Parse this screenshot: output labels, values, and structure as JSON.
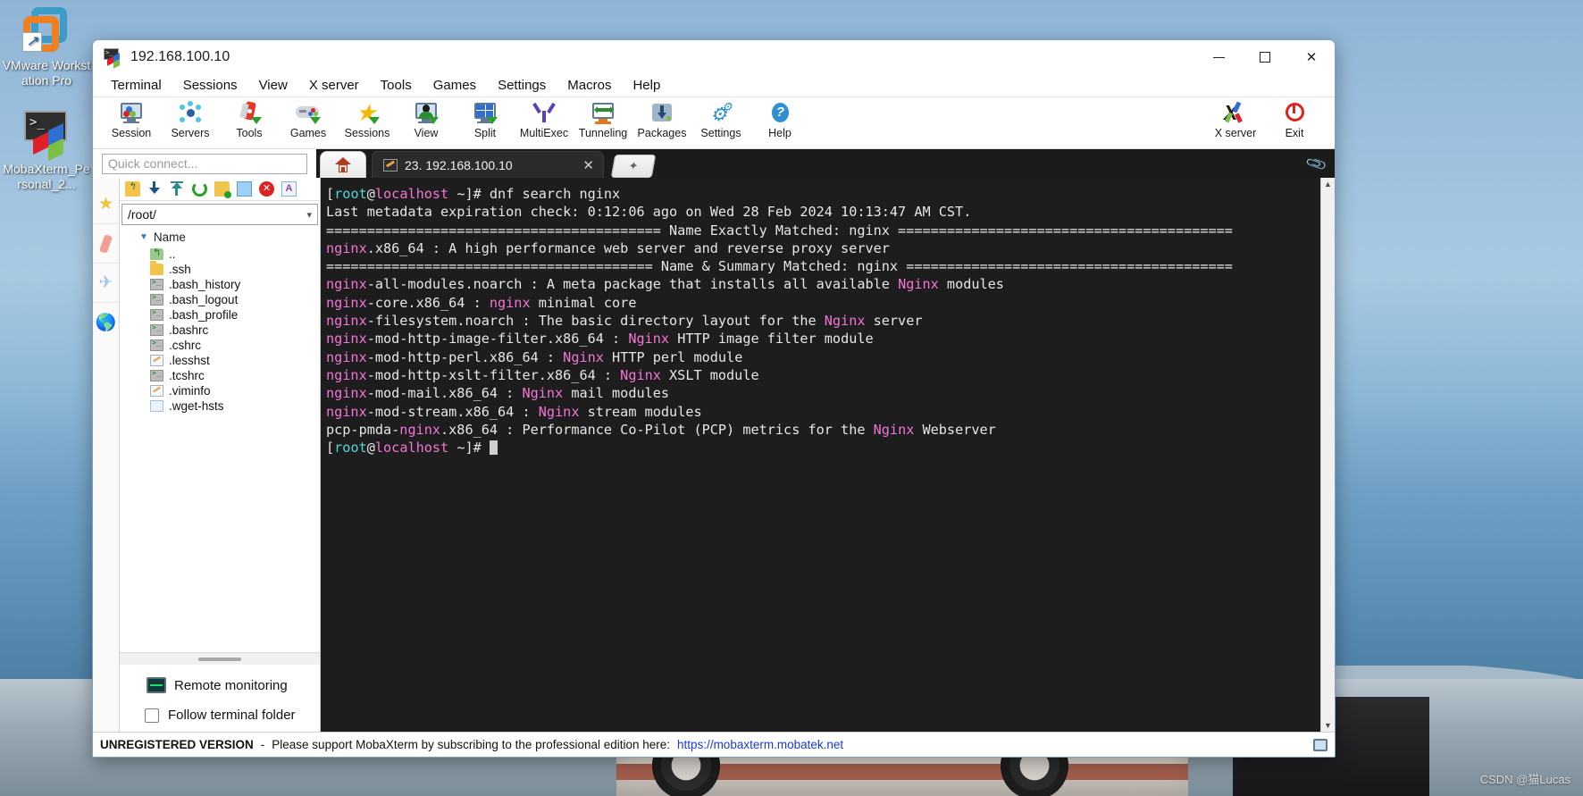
{
  "desktop": {
    "icons": [
      {
        "name": "vmware",
        "label": "VMware Workstation Pro"
      },
      {
        "name": "mobaxterm",
        "label": "MobaXterm_Personal_2..."
      }
    ],
    "watermark": "CSDN @猫Lucas"
  },
  "window": {
    "title": "192.168.100.10",
    "buttons": {
      "minimize": "—",
      "maximize": "□",
      "close": "✕"
    }
  },
  "menubar": [
    "Terminal",
    "Sessions",
    "View",
    "X server",
    "Tools",
    "Games",
    "Settings",
    "Macros",
    "Help"
  ],
  "toolbar": {
    "items": [
      {
        "label": "Session",
        "icon": "session-icon"
      },
      {
        "label": "Servers",
        "icon": "servers-icon"
      },
      {
        "label": "Tools",
        "icon": "tools-icon"
      },
      {
        "label": "Games",
        "icon": "games-icon"
      },
      {
        "label": "Sessions",
        "icon": "sessions-star-icon"
      },
      {
        "label": "View",
        "icon": "view-icon"
      },
      {
        "label": "Split",
        "icon": "split-icon"
      },
      {
        "label": "MultiExec",
        "icon": "multiexec-icon"
      },
      {
        "label": "Tunneling",
        "icon": "tunneling-icon"
      },
      {
        "label": "Packages",
        "icon": "packages-icon"
      },
      {
        "label": "Settings",
        "icon": "settings-icon"
      },
      {
        "label": "Help",
        "icon": "help-icon"
      }
    ],
    "right_items": [
      {
        "label": "X server",
        "icon": "xserver-icon"
      },
      {
        "label": "Exit",
        "icon": "exit-icon"
      }
    ]
  },
  "quick_connect": {
    "placeholder": "Quick connect...",
    "value": ""
  },
  "tabs": {
    "home_label": "",
    "items": [
      {
        "label": "23. 192.168.100.10",
        "close": "✕"
      }
    ],
    "new_tab_label": "✦"
  },
  "sidebar": {
    "rail_icons": [
      "favorites-star-icon",
      "tools-knife-icon",
      "sftp-plane-icon",
      "globe-icon"
    ],
    "tool_icons": [
      "upload-parent-icon",
      "download-icon",
      "upload-icon",
      "refresh-icon",
      "new-folder-icon",
      "new-file-icon",
      "delete-icon",
      "text-edit-icon"
    ],
    "path": "/root/",
    "column_header": "Name",
    "files": [
      {
        "name": "..",
        "type": "up"
      },
      {
        "name": ".ssh",
        "type": "folder"
      },
      {
        "name": ".bash_history",
        "type": "sh"
      },
      {
        "name": ".bash_logout",
        "type": "sh"
      },
      {
        "name": ".bash_profile",
        "type": "sh"
      },
      {
        "name": ".bashrc",
        "type": "sh"
      },
      {
        "name": ".cshrc",
        "type": "sh"
      },
      {
        "name": ".lesshst",
        "type": "txt"
      },
      {
        "name": ".tcshrc",
        "type": "sh"
      },
      {
        "name": ".viminfo",
        "type": "txt"
      },
      {
        "name": ".wget-hsts",
        "type": "plain"
      }
    ],
    "remote_monitoring_label": "Remote monitoring",
    "follow_terminal_folder_label": "Follow terminal folder",
    "follow_checked": false
  },
  "terminal": {
    "prompt_user": "root",
    "prompt_host": "localhost",
    "lines": [
      {
        "segments": [
          {
            "t": "[",
            "c": "white"
          },
          {
            "t": "root",
            "c": "cyan"
          },
          {
            "t": "@",
            "c": "white"
          },
          {
            "t": "localhost",
            "c": "mag"
          },
          {
            "t": " ~]# dnf search nginx",
            "c": "white"
          }
        ]
      },
      {
        "segments": [
          {
            "t": "Last metadata expiration check: 0:12:06 ago on Wed 28 Feb 2024 10:13:47 AM CST.",
            "c": "white"
          }
        ]
      },
      {
        "segments": [
          {
            "t": "========================================= Name Exactly Matched: nginx =========================================",
            "c": "white"
          }
        ]
      },
      {
        "segments": [
          {
            "t": "nginx",
            "c": "mag"
          },
          {
            "t": ".x86_64 : A high performance web server and reverse proxy server",
            "c": "white"
          }
        ]
      },
      {
        "segments": [
          {
            "t": "======================================== Name & Summary Matched: nginx ========================================",
            "c": "white"
          }
        ]
      },
      {
        "segments": [
          {
            "t": "nginx",
            "c": "mag"
          },
          {
            "t": "-all-modules.noarch : A meta package that installs all available ",
            "c": "white"
          },
          {
            "t": "Nginx",
            "c": "mag"
          },
          {
            "t": " modules",
            "c": "white"
          }
        ]
      },
      {
        "segments": [
          {
            "t": "nginx",
            "c": "mag"
          },
          {
            "t": "-core.x86_64 : ",
            "c": "white"
          },
          {
            "t": "nginx",
            "c": "mag"
          },
          {
            "t": " minimal core",
            "c": "white"
          }
        ]
      },
      {
        "segments": [
          {
            "t": "nginx",
            "c": "mag"
          },
          {
            "t": "-filesystem.noarch : The basic directory layout for the ",
            "c": "white"
          },
          {
            "t": "Nginx",
            "c": "mag"
          },
          {
            "t": " server",
            "c": "white"
          }
        ]
      },
      {
        "segments": [
          {
            "t": "nginx",
            "c": "mag"
          },
          {
            "t": "-mod-http-image-filter.x86_64 : ",
            "c": "white"
          },
          {
            "t": "Nginx",
            "c": "mag"
          },
          {
            "t": " HTTP image filter module",
            "c": "white"
          }
        ]
      },
      {
        "segments": [
          {
            "t": "nginx",
            "c": "mag"
          },
          {
            "t": "-mod-http-perl.x86_64 : ",
            "c": "white"
          },
          {
            "t": "Nginx",
            "c": "mag"
          },
          {
            "t": " HTTP perl module",
            "c": "white"
          }
        ]
      },
      {
        "segments": [
          {
            "t": "nginx",
            "c": "mag"
          },
          {
            "t": "-mod-http-xslt-filter.x86_64 : ",
            "c": "white"
          },
          {
            "t": "Nginx",
            "c": "mag"
          },
          {
            "t": " XSLT module",
            "c": "white"
          }
        ]
      },
      {
        "segments": [
          {
            "t": "nginx",
            "c": "mag"
          },
          {
            "t": "-mod-mail.x86_64 : ",
            "c": "white"
          },
          {
            "t": "Nginx",
            "c": "mag"
          },
          {
            "t": " mail modules",
            "c": "white"
          }
        ]
      },
      {
        "segments": [
          {
            "t": "nginx",
            "c": "mag"
          },
          {
            "t": "-mod-stream.x86_64 : ",
            "c": "white"
          },
          {
            "t": "Nginx",
            "c": "mag"
          },
          {
            "t": " stream modules",
            "c": "white"
          }
        ]
      },
      {
        "segments": [
          {
            "t": "pcp-pmda-",
            "c": "white"
          },
          {
            "t": "nginx",
            "c": "mag"
          },
          {
            "t": ".x86_64 : Performance Co-Pilot (PCP) metrics for the ",
            "c": "white"
          },
          {
            "t": "Nginx",
            "c": "mag"
          },
          {
            "t": " Webserver",
            "c": "white"
          }
        ]
      },
      {
        "segments": [
          {
            "t": "[",
            "c": "white"
          },
          {
            "t": "root",
            "c": "cyan"
          },
          {
            "t": "@",
            "c": "white"
          },
          {
            "t": "localhost",
            "c": "mag"
          },
          {
            "t": " ~]# ",
            "c": "white"
          }
        ],
        "cursor": true
      }
    ],
    "colors": {
      "background": "#1d1d1d",
      "foreground": "#e6e6e6",
      "magenta": "#f075d6",
      "cyan": "#56d6d6"
    }
  },
  "statusbar": {
    "unregistered": "UNREGISTERED VERSION",
    "dash": "-",
    "message": "Please support MobaXterm by subscribing to the professional edition here:",
    "link": "https://mobaxterm.mobatek.net"
  }
}
